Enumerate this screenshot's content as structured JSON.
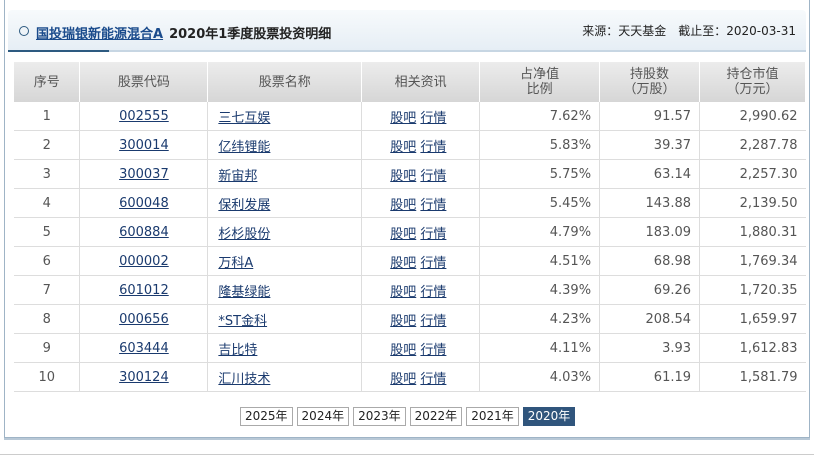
{
  "header": {
    "fund_name": "国投瑞银新能源混合A",
    "title": "2020年1季度股票投资明细",
    "source": "来源：天天基金",
    "date": "截止至：2020-03-31"
  },
  "columns": [
    "序号",
    "股票代码",
    "股票名称",
    "相关资讯",
    "占净值\n比例",
    "持股数\n（万股）",
    "持仓市值\n（万元）"
  ],
  "links": {
    "guba": "股吧",
    "hq": "行情"
  },
  "rows": [
    {
      "no": "1",
      "code": "002555",
      "name": "三七互娱",
      "pct": "7.62%",
      "shares": "91.57",
      "value": "2,990.62"
    },
    {
      "no": "2",
      "code": "300014",
      "name": "亿纬锂能",
      "pct": "5.83%",
      "shares": "39.37",
      "value": "2,287.78"
    },
    {
      "no": "3",
      "code": "300037",
      "name": "新宙邦",
      "pct": "5.75%",
      "shares": "63.14",
      "value": "2,257.30"
    },
    {
      "no": "4",
      "code": "600048",
      "name": "保利发展",
      "pct": "5.45%",
      "shares": "143.88",
      "value": "2,139.50"
    },
    {
      "no": "5",
      "code": "600884",
      "name": "杉杉股份",
      "pct": "4.79%",
      "shares": "183.09",
      "value": "1,880.31"
    },
    {
      "no": "6",
      "code": "000002",
      "name": "万科A",
      "pct": "4.51%",
      "shares": "68.98",
      "value": "1,769.34"
    },
    {
      "no": "7",
      "code": "601012",
      "name": "隆基绿能",
      "pct": "4.39%",
      "shares": "69.26",
      "value": "1,720.35"
    },
    {
      "no": "8",
      "code": "000656",
      "name": "*ST金科",
      "pct": "4.23%",
      "shares": "208.54",
      "value": "1,659.97"
    },
    {
      "no": "9",
      "code": "603444",
      "name": "吉比特",
      "pct": "4.11%",
      "shares": "3.93",
      "value": "1,612.83"
    },
    {
      "no": "10",
      "code": "300124",
      "name": "汇川技术",
      "pct": "4.03%",
      "shares": "61.19",
      "value": "1,581.79"
    }
  ],
  "years": [
    "2025年",
    "2024年",
    "2023年",
    "2022年",
    "2021年",
    "2020年"
  ],
  "active_year": "2020年"
}
